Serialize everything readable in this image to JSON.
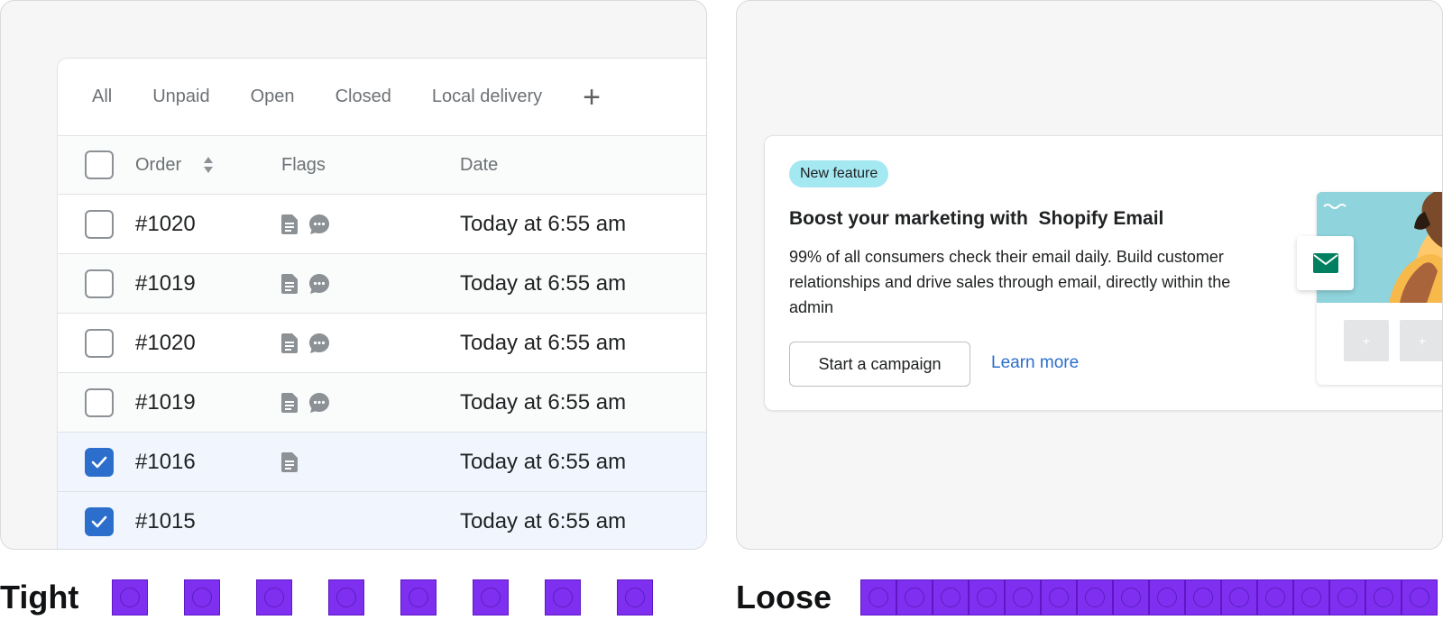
{
  "orders_panel": {
    "tabs": [
      "All",
      "Unpaid",
      "Open",
      "Closed",
      "Local delivery"
    ],
    "add_tab_symbol": "+",
    "columns": {
      "order": "Order",
      "flags": "Flags",
      "date": "Date"
    },
    "rows": [
      {
        "order": "#1020",
        "flags": [
          "document-icon",
          "chat-icon"
        ],
        "date": "Today at 6:55 am",
        "checked": false
      },
      {
        "order": "#1019",
        "flags": [
          "document-icon",
          "chat-icon"
        ],
        "date": "Today at 6:55 am",
        "checked": false
      },
      {
        "order": "#1020",
        "flags": [
          "document-icon",
          "chat-icon"
        ],
        "date": "Today at 6:55 am",
        "checked": false
      },
      {
        "order": "#1019",
        "flags": [
          "document-icon",
          "chat-icon"
        ],
        "date": "Today at 6:55 am",
        "checked": false
      },
      {
        "order": "#1016",
        "flags": [
          "document-icon"
        ],
        "date": "Today at 6:55 am",
        "checked": true
      },
      {
        "order": "#1015",
        "flags": [],
        "date": "Today at 6:55 am",
        "checked": true
      }
    ]
  },
  "marketing_card": {
    "badge": "New feature",
    "title": "Boost your marketing with  Shopify Email",
    "body": "99% of all consumers check their email daily. Build customer relationships and drive sales through email, directly within the admin",
    "primary_button": "Start a campaign",
    "link": "Learn more",
    "tile_symbol": "+"
  },
  "spacing_demo": {
    "tight_label": "Tight",
    "loose_label": "Loose",
    "tight_count": 8,
    "loose_count": 16
  },
  "colors": {
    "accent_blue": "#2c6ecb",
    "badge_cyan": "#a4e8f2",
    "demo_purple": "#7f2ff0",
    "email_green": "#008060"
  }
}
